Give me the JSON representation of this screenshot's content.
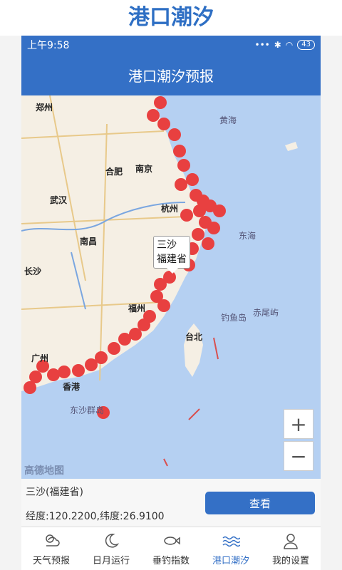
{
  "promo": {
    "title": "港口潮汐"
  },
  "status": {
    "time": "上午9:58",
    "signal": "•••",
    "battery": "43"
  },
  "app": {
    "title": "港口潮汐预报"
  },
  "map": {
    "callout": {
      "line1": "三沙",
      "line2": "福建省"
    },
    "watermark": "高德地图",
    "zoom_in": "+",
    "zoom_out": "−",
    "cities": [
      "郑州",
      "合肥",
      "南京",
      "武汉",
      "杭州",
      "南昌",
      "长沙",
      "福州",
      "台北",
      "广州",
      "香港"
    ],
    "seas": [
      "东海",
      "黄海",
      "钓鱼岛",
      "赤尾屿",
      "东沙群岛"
    ]
  },
  "info": {
    "station": "三沙(福建省)",
    "coord": "经度:120.2200,纬度:26.9100",
    "view_label": "查看"
  },
  "tabs": [
    {
      "label": "天气预报",
      "icon": "weather-icon"
    },
    {
      "label": "日月运行",
      "icon": "moon-icon"
    },
    {
      "label": "垂钓指数",
      "icon": "fish-icon"
    },
    {
      "label": "港口潮汐",
      "icon": "waves-icon"
    },
    {
      "label": "我的设置",
      "icon": "user-icon"
    }
  ],
  "colors": {
    "brand": "#3470c6",
    "marker": "#e84040",
    "water": "#b5d0f2",
    "land": "#f5efe4"
  }
}
